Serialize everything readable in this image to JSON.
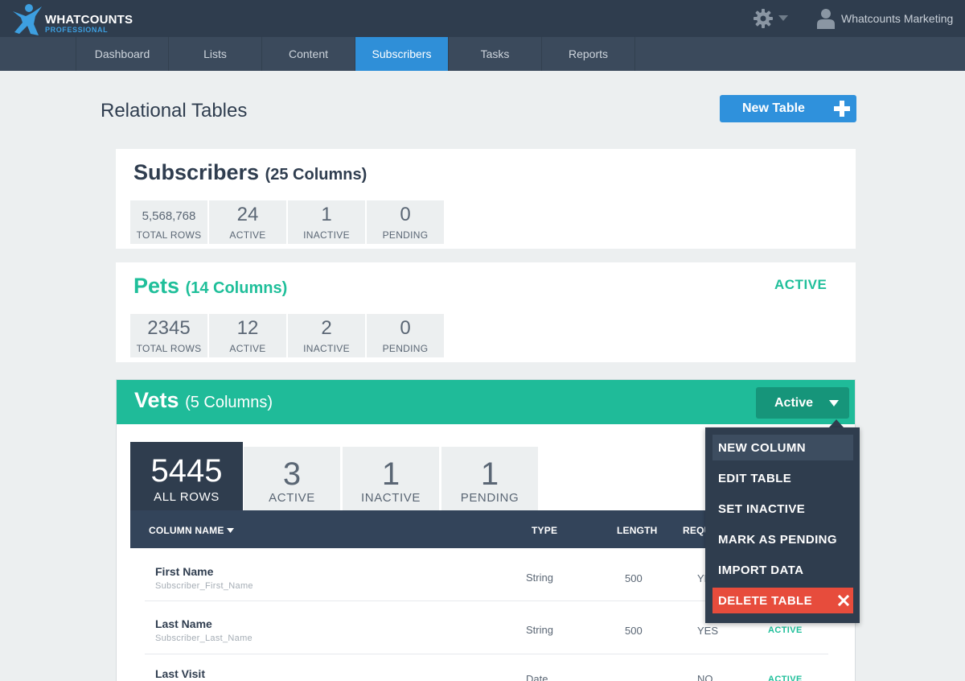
{
  "app": {
    "logo_main": "WHATCOUNTS",
    "logo_sub": "PROFESSIONAL",
    "user_name": "Whatcounts Marketing"
  },
  "nav": {
    "tabs": [
      "Dashboard",
      "Lists",
      "Content",
      "Subscribers",
      "Tasks",
      "Reports"
    ],
    "active": "Subscribers"
  },
  "page": {
    "title": "Relational Tables",
    "new_table_label": "New Table"
  },
  "tables": [
    {
      "name": "Subscribers",
      "columns_text": "(25 Columns)",
      "stats": [
        {
          "value": "5,568,768",
          "label": "TOTAL ROWS"
        },
        {
          "value": "24",
          "label": "ACTIVE"
        },
        {
          "value": "1",
          "label": "INACTIVE"
        },
        {
          "value": "0",
          "label": "PENDING"
        }
      ]
    },
    {
      "name": "Pets",
      "columns_text": "(14 Columns)",
      "status": "ACTIVE",
      "stats": [
        {
          "value": "2345",
          "label": "TOTAL ROWS"
        },
        {
          "value": "12",
          "label": "ACTIVE"
        },
        {
          "value": "2",
          "label": "INACTIVE"
        },
        {
          "value": "0",
          "label": "PENDING"
        }
      ]
    },
    {
      "name": "Vets",
      "columns_text": "(5 Columns)",
      "status_dropdown": "Active",
      "stats": [
        {
          "value": "5445",
          "label": "ALL ROWS"
        },
        {
          "value": "3",
          "label": "ACTIVE"
        },
        {
          "value": "1",
          "label": "INACTIVE"
        },
        {
          "value": "1",
          "label": "PENDING"
        }
      ],
      "column_headers": {
        "name": "COLUMN NAME",
        "type": "TYPE",
        "length": "LENGTH",
        "required": "REQU"
      },
      "rows": [
        {
          "name": "First Name",
          "field": "Subscriber_First_Name",
          "type": "String",
          "length": "500",
          "required": "YES",
          "status": ""
        },
        {
          "name": "Last Name",
          "field": "Subscriber_Last_Name",
          "type": "String",
          "length": "500",
          "required": "YES",
          "status": "ACTIVE"
        },
        {
          "name": "Last Visit",
          "field": "",
          "type": "Date",
          "length": "",
          "required": "NO",
          "status": "ACTIVE"
        }
      ]
    }
  ],
  "menu": {
    "items": [
      "NEW COLUMN",
      "EDIT TABLE",
      "SET INACTIVE",
      "MARK AS PENDING",
      "IMPORT DATA",
      "DELETE TABLE"
    ]
  },
  "icons": {
    "logo": "person-logo-icon",
    "settings": "gear-icon",
    "user": "user-icon",
    "add": "plus-icon",
    "dropdown": "caret-down-icon",
    "close": "close-icon"
  },
  "colors": {
    "topbar": "#2f3d4e",
    "nav": "#3b4a5c",
    "nav_active": "#2f8fd8",
    "accent_green": "#1fbb99",
    "primary_blue": "#2f91dc",
    "danger": "#e74c3c"
  }
}
